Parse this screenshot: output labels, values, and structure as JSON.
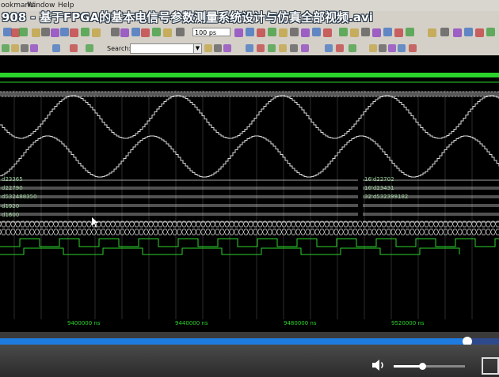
{
  "window_title": "908 - 基于FPGA的基本电信号参数测量系统设计与仿真全部视频.avi",
  "menu": {
    "bookmarks": "ookmarks",
    "window": "Window",
    "help": "Help"
  },
  "toolbar": {
    "unit_value": "100 ps",
    "search_label": "Search:",
    "search_value": ""
  },
  "signals": {
    "left_values": [
      "d23365",
      "d22790",
      "d532488350",
      "d1920",
      "d1600"
    ],
    "right_values": [
      "16'd22702",
      "16'd23431",
      "32'd532399182"
    ]
  },
  "timeline": {
    "ticks": [
      "9400000 ns",
      "9440000 ns",
      "9480000 ns",
      "9520000 ns"
    ]
  },
  "player": {
    "progress": 0.937,
    "volume": 0.4
  },
  "colors": {
    "wave": "#d8d8d8",
    "bus": "#2bd42b",
    "progress": "#1e7be0",
    "wave_bg": "#000000"
  }
}
